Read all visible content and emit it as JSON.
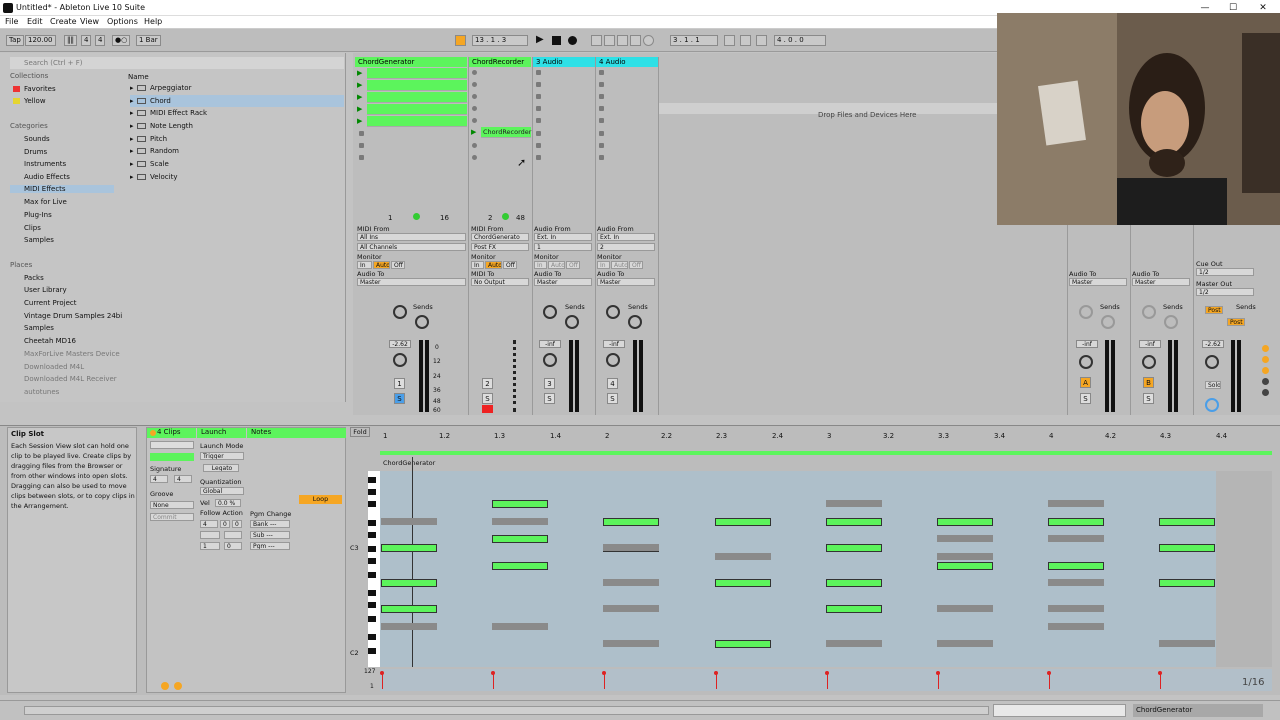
{
  "window": {
    "title": "Untitled* - Ableton Live 10 Suite",
    "minimize": "—",
    "maximize": "☐",
    "close": "✕"
  },
  "menu": [
    "File",
    "Edit",
    "Create",
    "View",
    "Options",
    "Help"
  ],
  "transport": {
    "tap": "Tap",
    "tempo": "120.00",
    "sig_num": "4",
    "sig_den": "4",
    "quant": "1 Bar",
    "pos": "13 . 1 . 3",
    "loop_start": "3 . 1 . 1",
    "loop_len": "4 . 0 . 0"
  },
  "browser": {
    "search_placeholder": "Search (Ctrl + F)",
    "collections_label": "Collections",
    "collections": [
      "Favorites",
      "Yellow"
    ],
    "categories_label": "Categories",
    "categories": [
      "Sounds",
      "Drums",
      "Instruments",
      "Audio Effects",
      "MIDI Effects",
      "Max for Live",
      "Plug-Ins",
      "Clips",
      "Samples"
    ],
    "places_label": "Places",
    "places": [
      "Packs",
      "User Library",
      "Current Project",
      "Vintage Drum Samples 24bi",
      "Samples",
      "Cheetah MD16",
      "MaxForLive Masters Device",
      "Downloaded M4L",
      "Downloaded M4L Receiver",
      "autotunes"
    ],
    "name_header": "Name",
    "items": [
      "Arpeggiator",
      "Chord",
      "MIDI Effect Rack",
      "Note Length",
      "Pitch",
      "Random",
      "Scale",
      "Velocity"
    ]
  },
  "tracks": [
    {
      "name": "ChordGenerator",
      "from_label": "MIDI From",
      "from": "All Ins",
      "channel": "All Channels",
      "to_label": "Audio To",
      "to": "Master",
      "vol": "-2.62",
      "num": "1",
      "color": "#5cf45c"
    },
    {
      "name": "ChordRecorder",
      "from_label": "MIDI From",
      "from": "ChordGenerato",
      "channel": "Post FX",
      "to_label": "MIDI To",
      "to": "No Output",
      "vol": "",
      "num": "2",
      "color": "#5cf45c"
    },
    {
      "name": "3 Audio",
      "from_label": "Audio From",
      "from": "Ext. In",
      "channel": "1",
      "to_label": "Audio To",
      "to": "Master",
      "vol": "-inf",
      "num": "3",
      "color": "#2ee0e6"
    },
    {
      "name": "4 Audio",
      "from_label": "Audio From",
      "from": "Ext. In",
      "channel": "2",
      "to_label": "Audio To",
      "to": "Master",
      "vol": "-inf",
      "num": "4",
      "color": "#2ee0e6"
    }
  ],
  "session": {
    "drop_text": "Drop Files and Devices Here",
    "recorder_clip": "ChordRecorder",
    "monitor_label": "Monitor",
    "in": "In",
    "auto": "Auto",
    "off": "Off",
    "sends_label": "Sends",
    "scene_nums": [
      "1",
      "16",
      "2",
      "48"
    ],
    "meter_ticks": [
      "0",
      "12",
      "24",
      "36",
      "48",
      "60"
    ],
    "solo": "S"
  },
  "returns": [
    {
      "to_label": "Audio To",
      "to": "Master",
      "vol": "-inf",
      "btn": "A"
    },
    {
      "to_label": "Audio To",
      "to": "Master",
      "vol": "-inf",
      "btn": "B"
    }
  ],
  "master": {
    "cue_label": "Cue Out",
    "cue": "1/2",
    "out_label": "Master Out",
    "out": "1/2",
    "vol": "-2.62",
    "post": "Post",
    "solo_label": "Solo"
  },
  "info": {
    "title": "Clip Slot",
    "text": "Each Session View slot can hold one clip to be played live. Create clips by dragging files from the Browser or from other windows into open slots. Dragging can also be used to move clips between slots, or to copy clips in the Arrangement."
  },
  "clip": {
    "header": "4 Clips",
    "signature_label": "Signature",
    "sig_num": "4",
    "sig_den": "4",
    "groove_label": "Groove",
    "groove": "None",
    "commit": "Commit",
    "launch_label": "Launch",
    "launch_mode_label": "Launch Mode",
    "launch_mode": "Trigger",
    "legato": "Legato",
    "quant_label": "Quantization",
    "quant": "Global",
    "vel_label": "Vel",
    "vel": "0.0 %",
    "follow_label": "Follow Action",
    "notes_label": "Notes",
    "pgm_label": "Pgm Change",
    "bank": "Bank ---",
    "sub": "Sub ---",
    "pgm": "Pgm ---",
    "loop": "Loop",
    "follow_vals": [
      "4",
      "0",
      "0",
      "1",
      "0"
    ]
  },
  "roll": {
    "fold": "Fold",
    "clip_name": "ChordGenerator",
    "ruler": [
      "1",
      "1.2",
      "1.3",
      "1.4",
      "2",
      "2.2",
      "2.3",
      "2.4",
      "3",
      "3.2",
      "3.3",
      "3.4",
      "4",
      "4.2",
      "4.3",
      "4.4"
    ],
    "c3": "C3",
    "c2": "C2",
    "vel_max": "127",
    "vel_min": "1",
    "page": "1/16"
  },
  "status": {
    "track": "ChordGenerator"
  }
}
